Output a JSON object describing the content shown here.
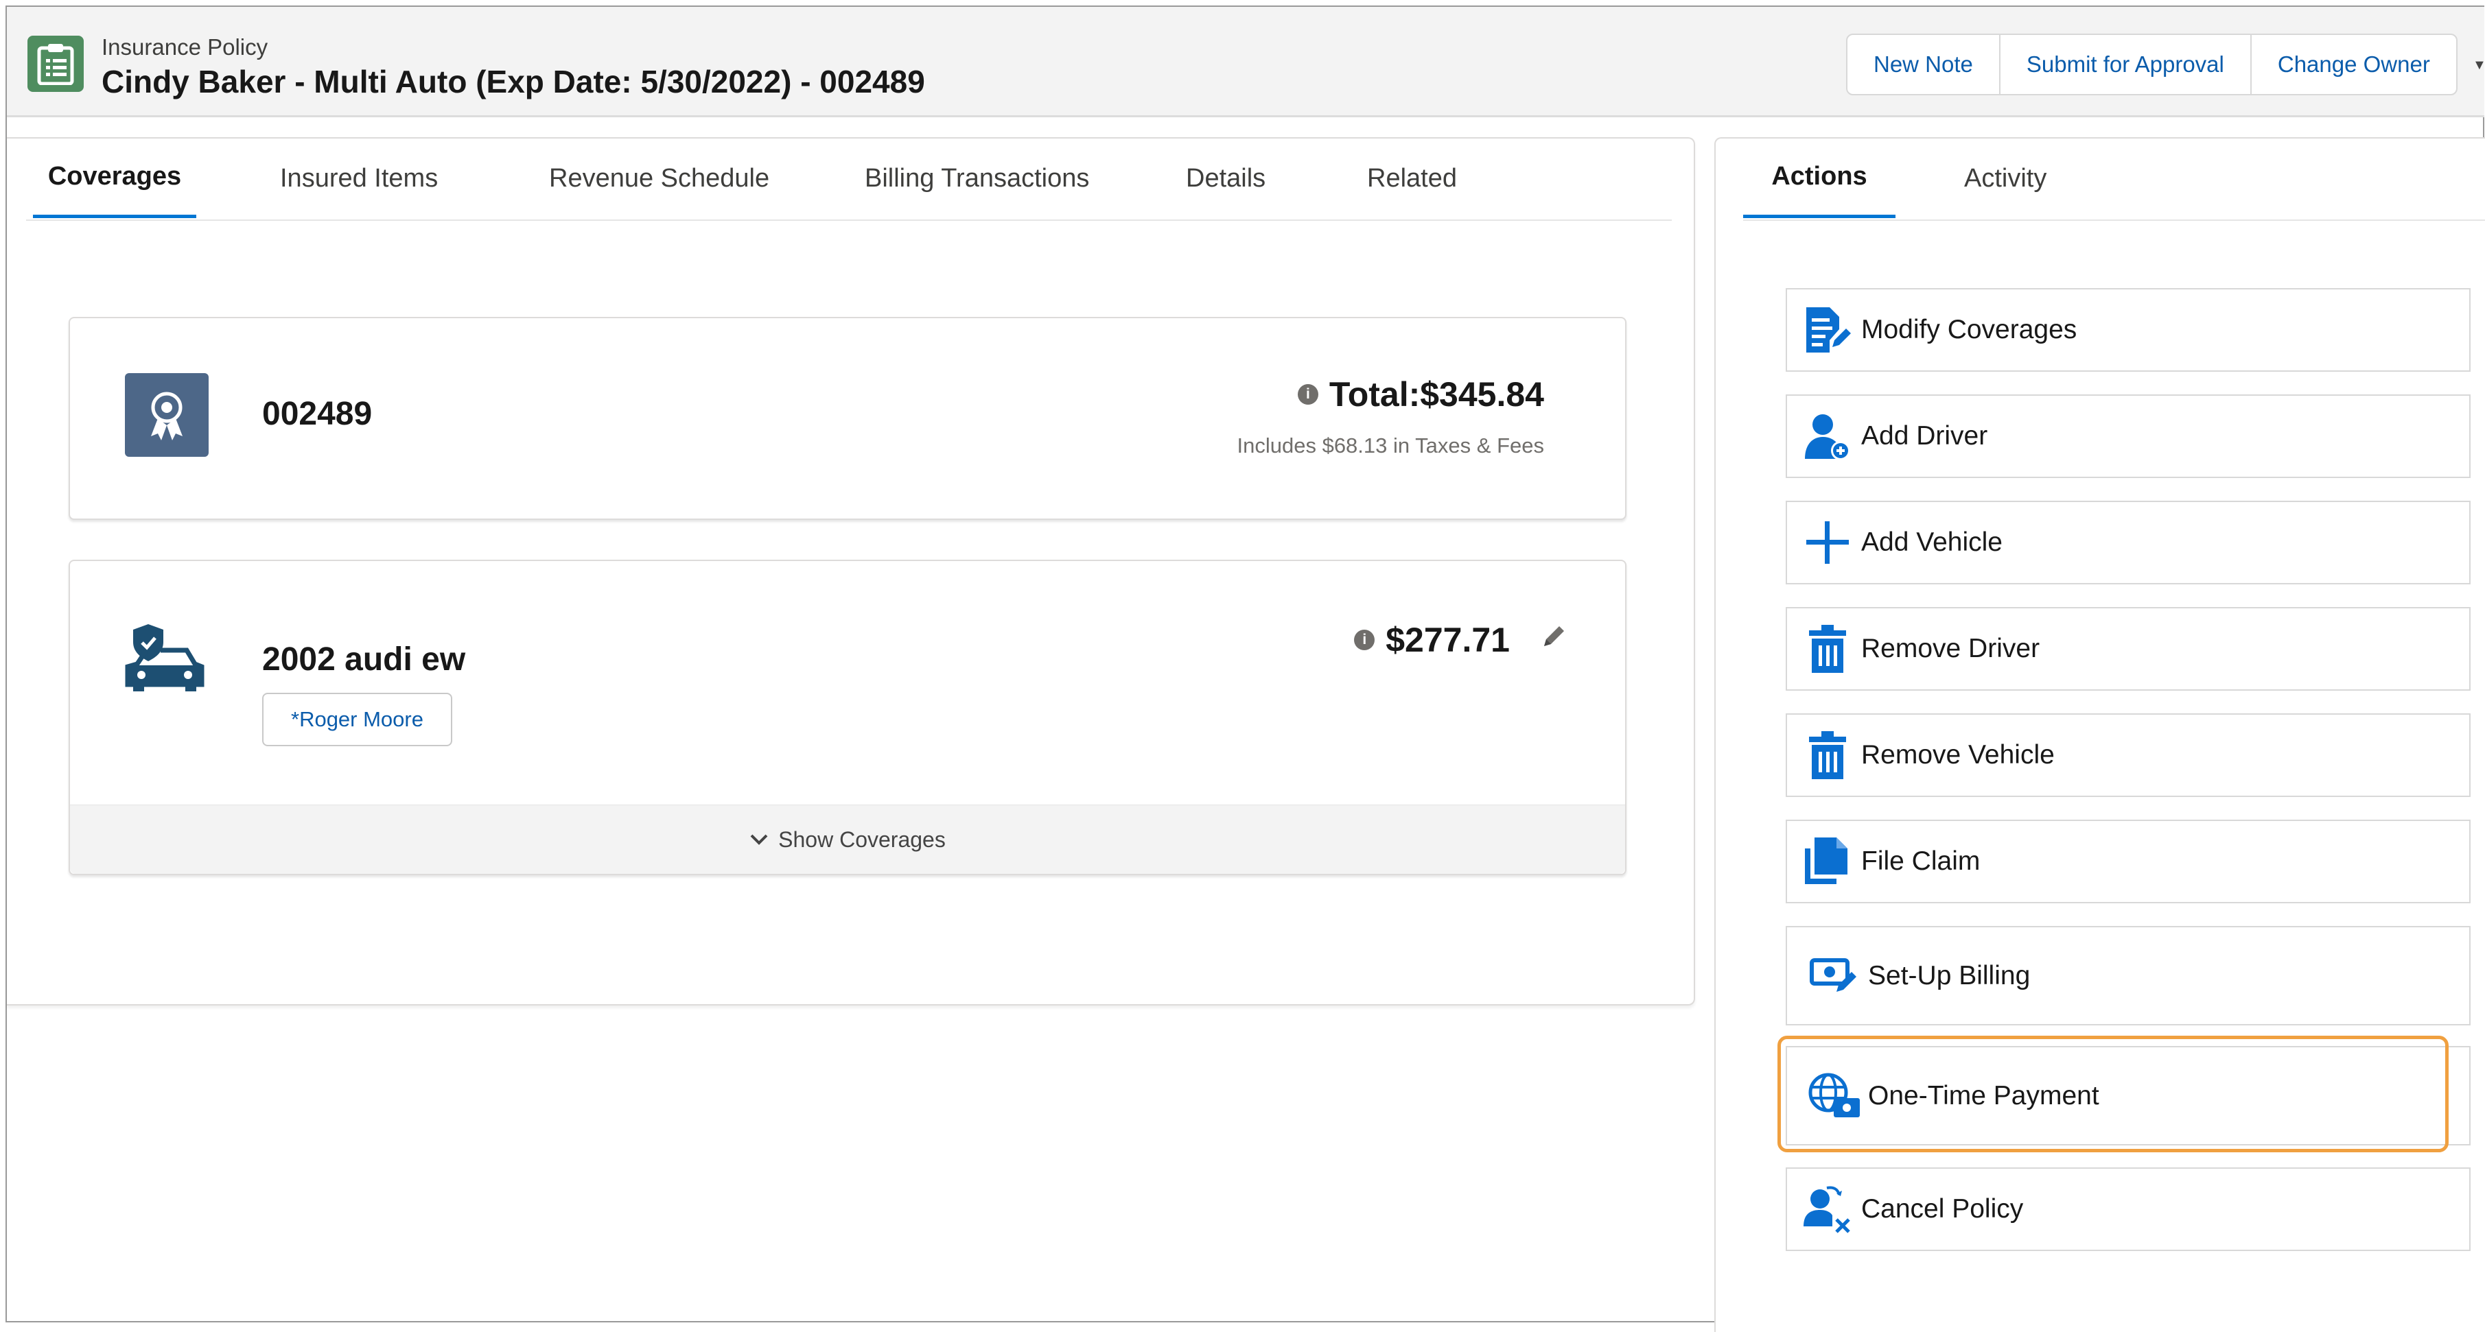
{
  "header": {
    "object_type": "Insurance Policy",
    "title": "Cindy Baker - Multi Auto (Exp Date: 5/30/2022) - 002489",
    "icon": "policy-record-icon",
    "buttons": [
      "New Note",
      "Submit for Approval",
      "Change Owner"
    ]
  },
  "tabs": [
    "Coverages",
    "Insured Items",
    "Revenue Schedule",
    "Billing Transactions",
    "Details",
    "Related"
  ],
  "active_tab": "Coverages",
  "policy_card": {
    "number": "002489",
    "total": "Total:$345.84",
    "taxes_note": "Includes $68.13 in Taxes & Fees"
  },
  "vehicle_card": {
    "name": "2002 audi ew",
    "driver": "*Roger Moore",
    "price": "$277.71",
    "show_coverages": "Show Coverages"
  },
  "right_tabs": [
    "Actions",
    "Activity"
  ],
  "active_right_tab": "Actions",
  "actions": [
    {
      "label": "Modify Coverages",
      "icon": "edit-document-icon"
    },
    {
      "label": "Add Driver",
      "icon": "add-person-icon"
    },
    {
      "label": "Add Vehicle",
      "icon": "plus-icon"
    },
    {
      "label": "Remove Driver",
      "icon": "trash-icon"
    },
    {
      "label": "Remove Vehicle",
      "icon": "trash-icon"
    },
    {
      "label": "File Claim",
      "icon": "file-copy-icon"
    },
    {
      "label": "Set-Up Billing",
      "icon": "billing-icon"
    },
    {
      "label": "One-Time Payment",
      "icon": "global-payment-icon"
    },
    {
      "label": "Cancel Policy",
      "icon": "remove-person-icon"
    }
  ],
  "highlighted_action": "One-Time Payment",
  "colors": {
    "brand_blue": "#0176d3",
    "link_blue": "#0b5cab",
    "action_icon_blue": "#0b6fd0",
    "record_icon_green": "#4f8d5f",
    "policy_badge_slate": "#4d6788",
    "vehicle_icon_navy": "#1d4f72",
    "highlight_orange": "#f0a040"
  }
}
